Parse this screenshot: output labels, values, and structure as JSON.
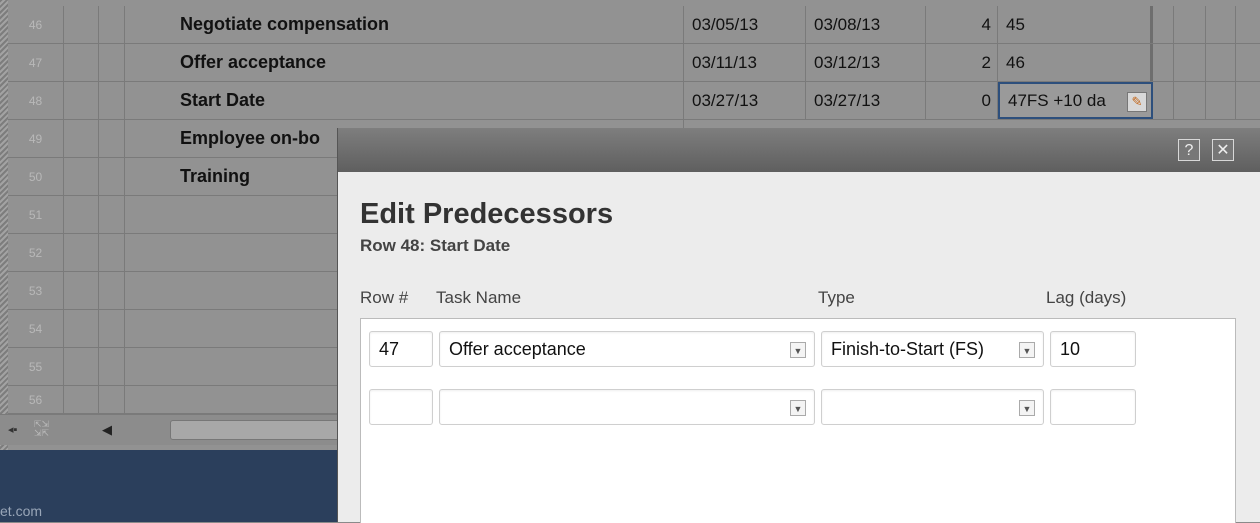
{
  "grid": {
    "rows": [
      {
        "num": "46",
        "task": "Negotiate compensation",
        "start": "03/05/13",
        "end": "03/08/13",
        "dur": "4",
        "pred": "45"
      },
      {
        "num": "47",
        "task": "Offer acceptance",
        "start": "03/11/13",
        "end": "03/12/13",
        "dur": "2",
        "pred": "46"
      },
      {
        "num": "48",
        "task": "Start Date",
        "start": "03/27/13",
        "end": "03/27/13",
        "dur": "0",
        "pred": "47FS +10 da"
      },
      {
        "num": "49",
        "task": "Employee on-bo",
        "start": "",
        "end": "",
        "dur": "",
        "pred": ""
      },
      {
        "num": "50",
        "task": "Training",
        "start": "",
        "end": "",
        "dur": "",
        "pred": ""
      },
      {
        "num": "51",
        "task": "",
        "start": "",
        "end": "",
        "dur": "",
        "pred": ""
      },
      {
        "num": "52",
        "task": "",
        "start": "",
        "end": "",
        "dur": "",
        "pred": ""
      },
      {
        "num": "53",
        "task": "",
        "start": "",
        "end": "",
        "dur": "",
        "pred": ""
      },
      {
        "num": "54",
        "task": "",
        "start": "",
        "end": "",
        "dur": "",
        "pred": ""
      },
      {
        "num": "55",
        "task": "",
        "start": "",
        "end": "",
        "dur": "",
        "pred": ""
      },
      {
        "num": "56",
        "task": "",
        "start": "",
        "end": "",
        "dur": "",
        "pred": ""
      }
    ]
  },
  "footer": {
    "brand": "et.com"
  },
  "dialog": {
    "help_label": "?",
    "close_label": "✕",
    "title": "Edit Predecessors",
    "subtitle": "Row 48: Start Date",
    "headers": {
      "row": "Row #",
      "task": "Task Name",
      "type": "Type",
      "lag": "Lag (days)"
    },
    "entries": [
      {
        "row": "47",
        "task": "Offer acceptance",
        "type": "Finish-to-Start (FS)",
        "lag": "10"
      },
      {
        "row": "",
        "task": "",
        "type": "",
        "lag": ""
      }
    ]
  },
  "icons": {
    "dropdown": "chevron-down-icon",
    "pencil": "pencil-icon",
    "help": "help-icon",
    "close": "close-icon"
  }
}
